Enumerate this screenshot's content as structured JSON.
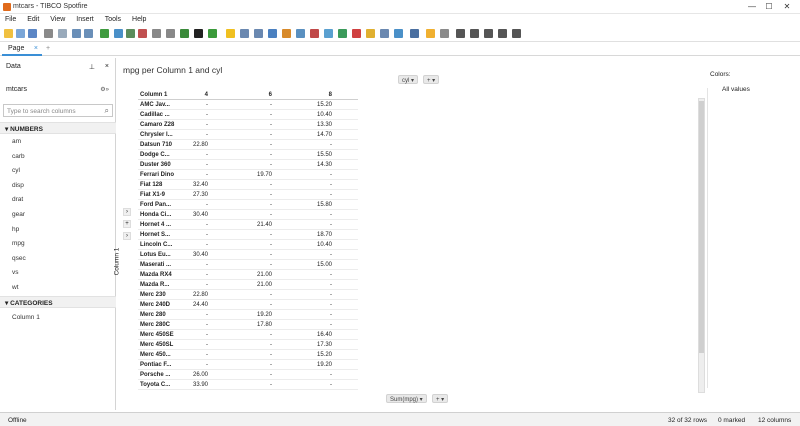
{
  "window": {
    "title": "mtcars - TIBCO Spotfire",
    "minimize": "—",
    "maximize": "☐",
    "close": "✕"
  },
  "menu": [
    "File",
    "Edit",
    "View",
    "Insert",
    "Tools",
    "Help"
  ],
  "tabs": {
    "active": "Page",
    "close": "×",
    "add": "+"
  },
  "data_panel": {
    "title": "Data",
    "pin": "⊥",
    "close": "×",
    "source": "mtcars",
    "source_icons": "⚙»",
    "search_placeholder": "Type to search columns",
    "numbers_label": "NUMBERS",
    "numbers": [
      "am",
      "carb",
      "cyl",
      "disp",
      "drat",
      "gear",
      "hp",
      "mpg",
      "qsec",
      "vs",
      "wt"
    ],
    "categories_label": "CATEGORIES",
    "categories": [
      "Column 1"
    ]
  },
  "viz": {
    "title": "mpg per Column 1 and cyl",
    "col_axis": "cyl",
    "row_axis": "Column 1",
    "value_axis": "Sum(mpg)",
    "colors_label": "Colors:",
    "colors_value": "All values",
    "headers": [
      "Column 1",
      "4",
      "6",
      "8"
    ],
    "rows": [
      [
        "AMC Jav...",
        "-",
        "-",
        "15.20"
      ],
      [
        "Cadillac ...",
        "-",
        "-",
        "10.40"
      ],
      [
        "Camaro Z28",
        "-",
        "-",
        "13.30"
      ],
      [
        "Chrysler I...",
        "-",
        "-",
        "14.70"
      ],
      [
        "Datsun 710",
        "22.80",
        "-",
        "-"
      ],
      [
        "Dodge C...",
        "-",
        "-",
        "15.50"
      ],
      [
        "Duster 360",
        "-",
        "-",
        "14.30"
      ],
      [
        "Ferrari Dino",
        "-",
        "19.70",
        "-"
      ],
      [
        "Fiat 128",
        "32.40",
        "-",
        "-"
      ],
      [
        "Fiat X1-9",
        "27.30",
        "-",
        "-"
      ],
      [
        "Ford Pan...",
        "-",
        "-",
        "15.80"
      ],
      [
        "Honda Ci...",
        "30.40",
        "-",
        "-"
      ],
      [
        "Hornet 4 ...",
        "-",
        "21.40",
        "-"
      ],
      [
        "Hornet S...",
        "-",
        "-",
        "18.70"
      ],
      [
        "Lincoln C...",
        "-",
        "-",
        "10.40"
      ],
      [
        "Lotus Eu...",
        "30.40",
        "-",
        "-"
      ],
      [
        "Maserati ...",
        "-",
        "-",
        "15.00"
      ],
      [
        "Mazda RX4",
        "-",
        "21.00",
        "-"
      ],
      [
        "Mazda R...",
        "-",
        "21.00",
        "-"
      ],
      [
        "Merc 230",
        "22.80",
        "-",
        "-"
      ],
      [
        "Merc 240D",
        "24.40",
        "-",
        "-"
      ],
      [
        "Merc 280",
        "-",
        "19.20",
        "-"
      ],
      [
        "Merc 280C",
        "-",
        "17.80",
        "-"
      ],
      [
        "Merc 450SE",
        "-",
        "-",
        "16.40"
      ],
      [
        "Merc 450SL",
        "-",
        "-",
        "17.30"
      ],
      [
        "Merc 450...",
        "-",
        "-",
        "15.20"
      ],
      [
        "Pontiac F...",
        "-",
        "-",
        "19.20"
      ],
      [
        "Porsche ...",
        "26.00",
        "-",
        "-"
      ],
      [
        "Toyota C...",
        "33.90",
        "-",
        "-"
      ]
    ]
  },
  "status": {
    "left": "Offline",
    "rows": "32 of 32 rows",
    "marked": "0 marked",
    "columns": "12 columns"
  }
}
